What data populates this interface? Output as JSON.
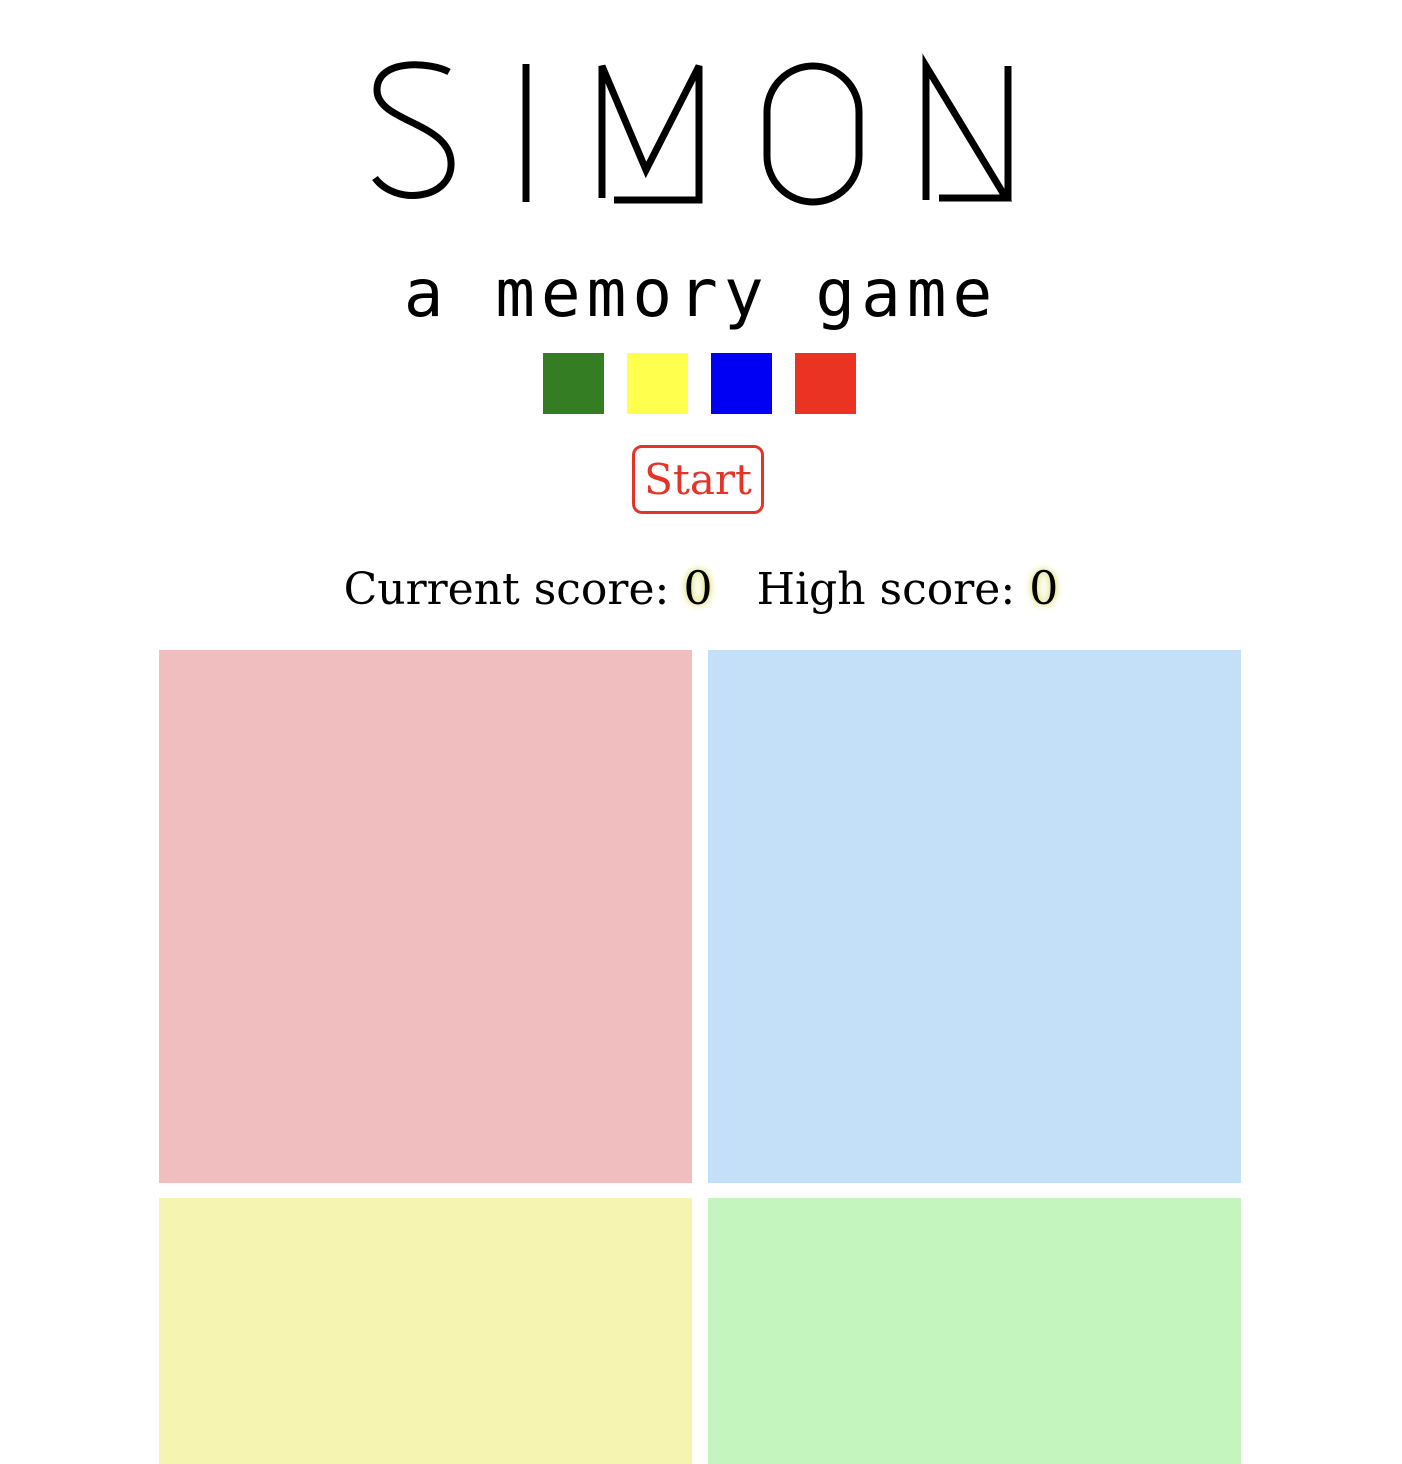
{
  "title": "SIMON",
  "subtitle": "a memory game",
  "swatches": [
    {
      "name": "green",
      "color": "#357d22"
    },
    {
      "name": "yellow",
      "color": "#ffff4d"
    },
    {
      "name": "blue",
      "color": "#0000f5"
    },
    {
      "name": "red",
      "color": "#ea3323"
    }
  ],
  "start_label": "Start",
  "scores": {
    "current_label": "Current score:",
    "current_value": "0",
    "high_label": "High score:",
    "high_value": "0"
  },
  "pads": {
    "red": "#f0bebe",
    "blue": "#c3e0f8",
    "yellow": "#f5f5b1",
    "green": "#c5f5be"
  }
}
